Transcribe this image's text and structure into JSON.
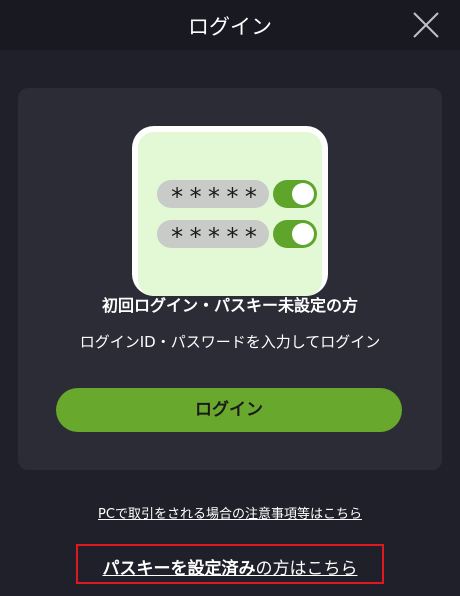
{
  "header": {
    "title": "ログイン",
    "close_icon": "close-icon"
  },
  "card": {
    "illustration": {
      "password_mask_1": "*****",
      "password_mask_2": "*****",
      "toggle_state": "on"
    },
    "title": "初回ログイン・パスキー未設定の方",
    "description": "ログインID・パスワードを入力してログイン",
    "login_button_label": "ログイン"
  },
  "links": {
    "pc_notice": "PCで取引をされる場合の注意事項等はこちら",
    "passkey_bold": "パスキーを設定済み",
    "passkey_rest": "の方はこちら"
  },
  "colors": {
    "background": "#1f2029",
    "header": "#191a21",
    "card": "#2b2c36",
    "accent_green": "#67a82d",
    "highlight_red": "#e1181e"
  }
}
